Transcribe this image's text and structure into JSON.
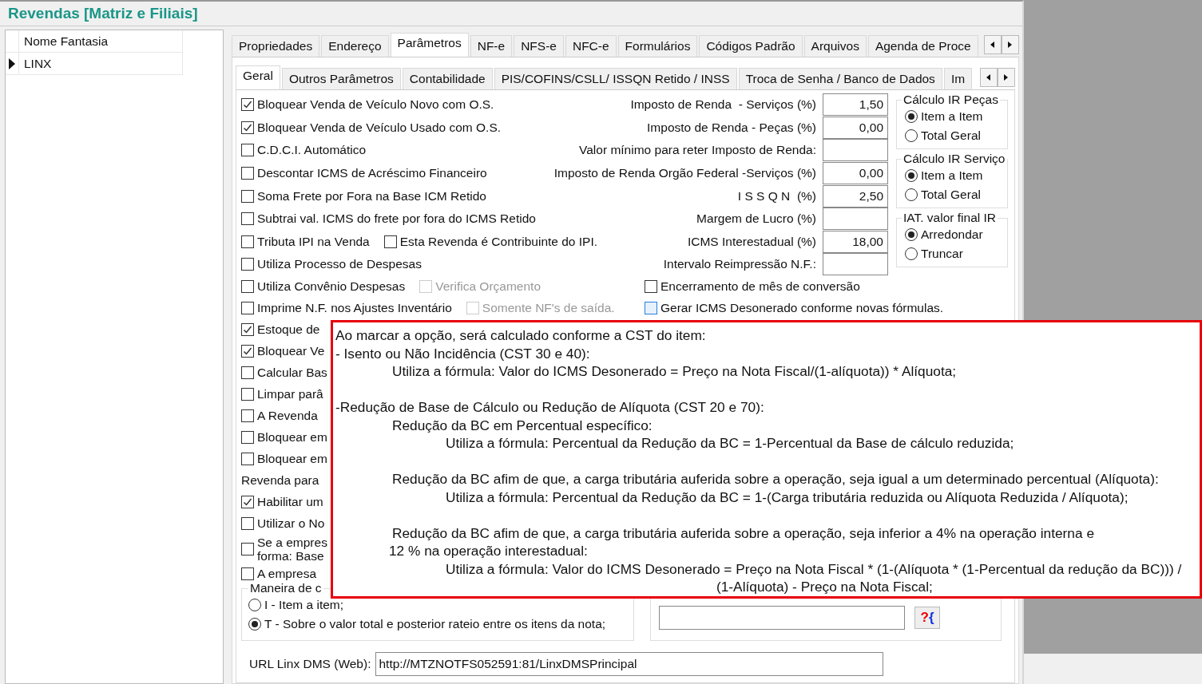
{
  "window": {
    "title": "Revendas [Matriz e Filiais]"
  },
  "list": {
    "column": "Nome Fantasia",
    "rows": [
      {
        "name": "LINX",
        "selected": true
      }
    ]
  },
  "tabs": [
    {
      "label": "Propriedades",
      "selected": false
    },
    {
      "label": "Endereço",
      "selected": false
    },
    {
      "label": "Parâmetros",
      "selected": true
    },
    {
      "label": "NF-e",
      "selected": false
    },
    {
      "label": "NFS-e",
      "selected": false
    },
    {
      "label": "NFC-e",
      "selected": false
    },
    {
      "label": "Formulários",
      "selected": false
    },
    {
      "label": "Códigos Padrão",
      "selected": false
    },
    {
      "label": "Arquivos",
      "selected": false
    },
    {
      "label": "Agenda de Proce",
      "selected": false
    }
  ],
  "subtabs": [
    {
      "label": "Geral",
      "selected": true
    },
    {
      "label": "Outros Parâmetros",
      "selected": false
    },
    {
      "label": "Contabilidade",
      "selected": false
    },
    {
      "label": "PIS/COFINS/CSLL/ ISSQN Retido / INSS",
      "selected": false
    },
    {
      "label": "Troca de Senha / Banco de Dados",
      "selected": false
    },
    {
      "label": "Im",
      "selected": false
    }
  ],
  "rows": [
    {
      "checks": [
        {
          "label": "Bloquear Venda de Veículo Novo com O.S.",
          "checked": true,
          "disabled": false
        }
      ],
      "field": {
        "label": "Imposto de Renda  - Serviços (%)",
        "value": "1,50"
      }
    },
    {
      "checks": [
        {
          "label": "Bloquear Venda de Veículo Usado com O.S.",
          "checked": true,
          "disabled": false
        }
      ],
      "field": {
        "label": "Imposto de Renda - Peças (%)",
        "value": "0,00"
      }
    },
    {
      "checks": [
        {
          "label": "C.D.C.I. Automático",
          "checked": false,
          "disabled": false
        }
      ],
      "field": {
        "label": "Valor mínimo para reter Imposto de Renda:"
      }
    },
    {
      "checks": [
        {
          "label": "Descontar ICMS de Acréscimo Financeiro",
          "checked": false,
          "disabled": false
        }
      ],
      "field": {
        "label": "Imposto de Renda Orgão Federal -Serviços (%)",
        "value": "0,00"
      }
    },
    {
      "checks": [
        {
          "label": "Soma Frete por Fora na Base ICM Retido",
          "checked": false,
          "disabled": false
        }
      ],
      "field": {
        "label": "I S S Q N  (%)",
        "value": "2,50"
      }
    },
    {
      "checks": [
        {
          "label": "Subtrai  val. ICMS do frete por fora do ICMS Retido",
          "checked": false,
          "disabled": false
        }
      ],
      "field": {
        "label": "Margem de Lucro (%)"
      }
    },
    {
      "checks": [
        {
          "label": "Tributa IPI na Venda",
          "checked": false,
          "disabled": false
        },
        {
          "label": "Esta Revenda é Contribuinte do IPI.",
          "checked": false,
          "disabled": false
        }
      ],
      "field": {
        "label": "ICMS Interestadual (%)",
        "value": "18,00"
      }
    },
    {
      "checks": [
        {
          "label": "Utiliza Processo de Despesas",
          "checked": false,
          "disabled": false
        }
      ],
      "field": {
        "label": "Intervalo Reimpressão N.F.:"
      }
    },
    {
      "checks": [
        {
          "label": "Utiliza Convênio Despesas",
          "checked": false,
          "disabled": false
        },
        {
          "label": "Verifica Orçamento",
          "checked": false,
          "disabled": true
        }
      ],
      "right_check": {
        "label": "Encerramento de mês de conversão",
        "checked": false,
        "focused": false
      }
    },
    {
      "checks": [
        {
          "label": "Imprime N.F. nos Ajustes Inventário",
          "checked": false,
          "disabled": false
        },
        {
          "label": "Somente NF's de saída.",
          "checked": false,
          "disabled": true
        }
      ],
      "right_check": {
        "label": "Gerar ICMS Desonerado conforme novas fórmulas.",
        "checked": false,
        "focused": true
      }
    }
  ],
  "groups": [
    {
      "title": "Cálculo IR Peças",
      "options": [
        {
          "label": "Item a Item",
          "selected": true
        },
        {
          "label": "Total Geral",
          "selected": false
        }
      ]
    },
    {
      "title": "Cálculo IR Serviço",
      "options": [
        {
          "label": "Item a Item",
          "selected": true
        },
        {
          "label": "Total Geral",
          "selected": false
        }
      ]
    },
    {
      "title": "IAT. valor final IR",
      "options": [
        {
          "label": "Arredondar",
          "selected": true
        },
        {
          "label": "Truncar",
          "selected": false
        }
      ]
    }
  ],
  "lower_items": [
    {
      "kind": "checkbox",
      "label": "Estoque de",
      "checked": true
    },
    {
      "kind": "checkbox",
      "label": "Bloquear Ve",
      "checked": true
    },
    {
      "kind": "checkbox",
      "label": "Calcular Bas",
      "checked": false
    },
    {
      "kind": "checkbox",
      "label": "Limpar parâ",
      "checked": false
    },
    {
      "kind": "checkbox",
      "label": "A Revenda",
      "checked": false
    },
    {
      "kind": "checkbox",
      "label": "Bloquear em",
      "checked": false
    },
    {
      "kind": "checkbox",
      "label": "Bloquear em",
      "checked": false
    },
    {
      "kind": "label",
      "label": "Revenda para"
    },
    {
      "kind": "checkbox",
      "label": "Habilitar um",
      "checked": true
    },
    {
      "kind": "checkbox",
      "label": "Utilizar o No",
      "checked": false
    },
    {
      "kind": "checkbox",
      "label": "Se a empres\nforma: Base",
      "checked": false
    },
    {
      "kind": "checkbox",
      "label": "A empresa",
      "checked": false
    }
  ],
  "calc_group": {
    "title": "Maneira de c",
    "options": [
      {
        "label": "I - Item a item;",
        "selected": false
      },
      {
        "label": "T - Sobre o valor total e posterior rateio entre os itens da nota;",
        "selected": true
      }
    ]
  },
  "approval": {
    "button": "?{"
  },
  "url": {
    "label": "URL Linx DMS (Web):",
    "value": "http://MTZNOTFS052591:81/LinxDMSPrincipal"
  },
  "tooltip": {
    "paragraphs": [
      {
        "lines": [
          {
            "kind": "intro",
            "text": "Ao marcar a opção, será calculado conforme a CST do item:"
          },
          {
            "kind": "intro",
            "text": "- Isento ou Não Incidência (CST 30 e 40):"
          },
          {
            "kind": "item",
            "text": "Utiliza a fórmula: Valor do ICMS Desonerado = Preço na Nota Fiscal/(1-alíquota)) * Alíquota;"
          }
        ]
      },
      {
        "lines": [
          {
            "kind": "intro",
            "text": "-Redução de Base de Cálculo ou Redução de Alíquota (CST 20 e 70):"
          },
          {
            "kind": "item",
            "text": "Redução da BC em Percentual específico:"
          },
          {
            "kind": "formula",
            "text": "Utiliza a fórmula: Percentual da Redução da BC = 1-Percentual da Base de cálculo reduzida;"
          }
        ]
      },
      {
        "lines": [
          {
            "kind": "item",
            "text": "Redução da BC afim de que, a carga tributária auferida sobre a operação, seja igual a um determinado percentual (Alíquota):"
          },
          {
            "kind": "formula",
            "text": "Utiliza a fórmula: Percentual da Redução da BC = 1-(Carga tributária reduzida ou Alíquota Reduzida / Alíquota);"
          }
        ]
      },
      {
        "lines": [
          {
            "kind": "item",
            "text": "Redução da BC afim de que, a carga tributária auferida sobre a operação, seja inferior a 4% na operação interna e"
          },
          {
            "kind": "wrap",
            "text": "12 % na operação interestadual:"
          },
          {
            "kind": "formula",
            "text": "Utiliza a fórmula: Valor do ICMS Desonerado = Preço na Nota Fiscal * (1-(Alíquota * (1-Percentual da redução da BC))) /"
          },
          {
            "kind": "continuation",
            "text": "(1-Alíquota) - Preço na Nota Fiscal;"
          }
        ]
      }
    ]
  }
}
